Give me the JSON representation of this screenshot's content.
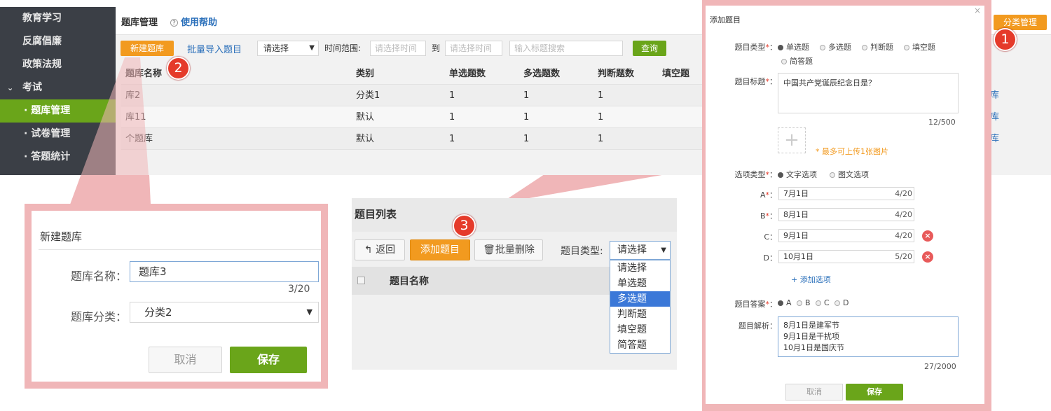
{
  "sidebar": {
    "items": [
      {
        "label": "教育学习"
      },
      {
        "label": "反腐倡廉"
      },
      {
        "label": "政策法规"
      },
      {
        "label": "考试"
      },
      {
        "label": "· 题库管理"
      },
      {
        "label": "· 试卷管理"
      },
      {
        "label": "· 答题统计"
      }
    ]
  },
  "header": {
    "title": "题库管理",
    "help": "使用帮助",
    "category_button": "分类管理"
  },
  "toolbar": {
    "new_button": "新建题库",
    "import_link": "批量导入题目",
    "filter_select": "请选择",
    "time_label": "时间范围:",
    "time_from_placeholder": "请选择时间",
    "to_label": "到",
    "time_to_placeholder": "请选择时间",
    "search_placeholder": "输入标题搜索",
    "query_button": "查询"
  },
  "table": {
    "headers": [
      "题库名称",
      "类别",
      "单选题数",
      "多选题数",
      "判断题数",
      "填空题"
    ],
    "rows": [
      {
        "name": "库2",
        "category": "分类1",
        "single": "1",
        "multi": "1",
        "judge": "1",
        "action": "库"
      },
      {
        "name": "库11",
        "category": "默认",
        "single": "1",
        "multi": "1",
        "judge": "1",
        "action": "库"
      },
      {
        "name": "个题库",
        "category": "默认",
        "single": "1",
        "multi": "1",
        "judge": "1",
        "action": "库"
      }
    ]
  },
  "badges": {
    "b1": "1",
    "b2": "2",
    "b3": "3"
  },
  "new_bank_dialog": {
    "title": "新建题库",
    "name_label": "题库名称：",
    "name_value": "题库3",
    "name_count": "3/20",
    "category_label": "题库分类：",
    "category_value": "分类2",
    "cancel": "取消",
    "save": "保存"
  },
  "question_list": {
    "title": "题目列表",
    "back": "返回",
    "add": "添加题目",
    "batch_delete": "批量删除",
    "type_label": "题目类型:",
    "type_select": "请选择",
    "column_name": "题目名称",
    "dropdown": [
      "请选择",
      "单选题",
      "多选题",
      "判断题",
      "填空题",
      "简答题"
    ],
    "dropdown_selected": "多选题"
  },
  "add_question_dialog": {
    "title": "添加题目",
    "type_label": "题目类型",
    "types": [
      "单选题",
      "多选题",
      "判断题",
      "填空题",
      "简答题"
    ],
    "title_label": "题目标题",
    "title_value": "中国共产党诞辰纪念日是？",
    "title_count": "12/500",
    "upload_hint": "* 最多可上传1张图片",
    "option_type_label": "选项类型",
    "option_types": [
      "文字选项",
      "图文选项"
    ],
    "options": [
      {
        "key": "A",
        "value": "7月1日",
        "count": "4/20"
      },
      {
        "key": "B",
        "value": "8月1日",
        "count": "4/20"
      },
      {
        "key": "C",
        "value": "9月1日",
        "count": "4/20"
      },
      {
        "key": "D",
        "value": "10月1日",
        "count": "5/20"
      }
    ],
    "add_option": "+ 添加选项",
    "answer_label": "题目答案",
    "answers": [
      "A",
      "B",
      "C",
      "D"
    ],
    "analysis_label": "题目解析：",
    "analysis_lines": [
      "8月1日是建军节",
      "9月1日是干扰项",
      "10月1日是国庆节"
    ],
    "analysis_count": "27/2000",
    "cancel": "取消",
    "save": "保存"
  },
  "colors": {
    "accent_orange": "#f29a1f",
    "accent_green": "#6aa51a",
    "callout_pink": "#f0b6b8",
    "badge_red": "#e53a2a"
  }
}
